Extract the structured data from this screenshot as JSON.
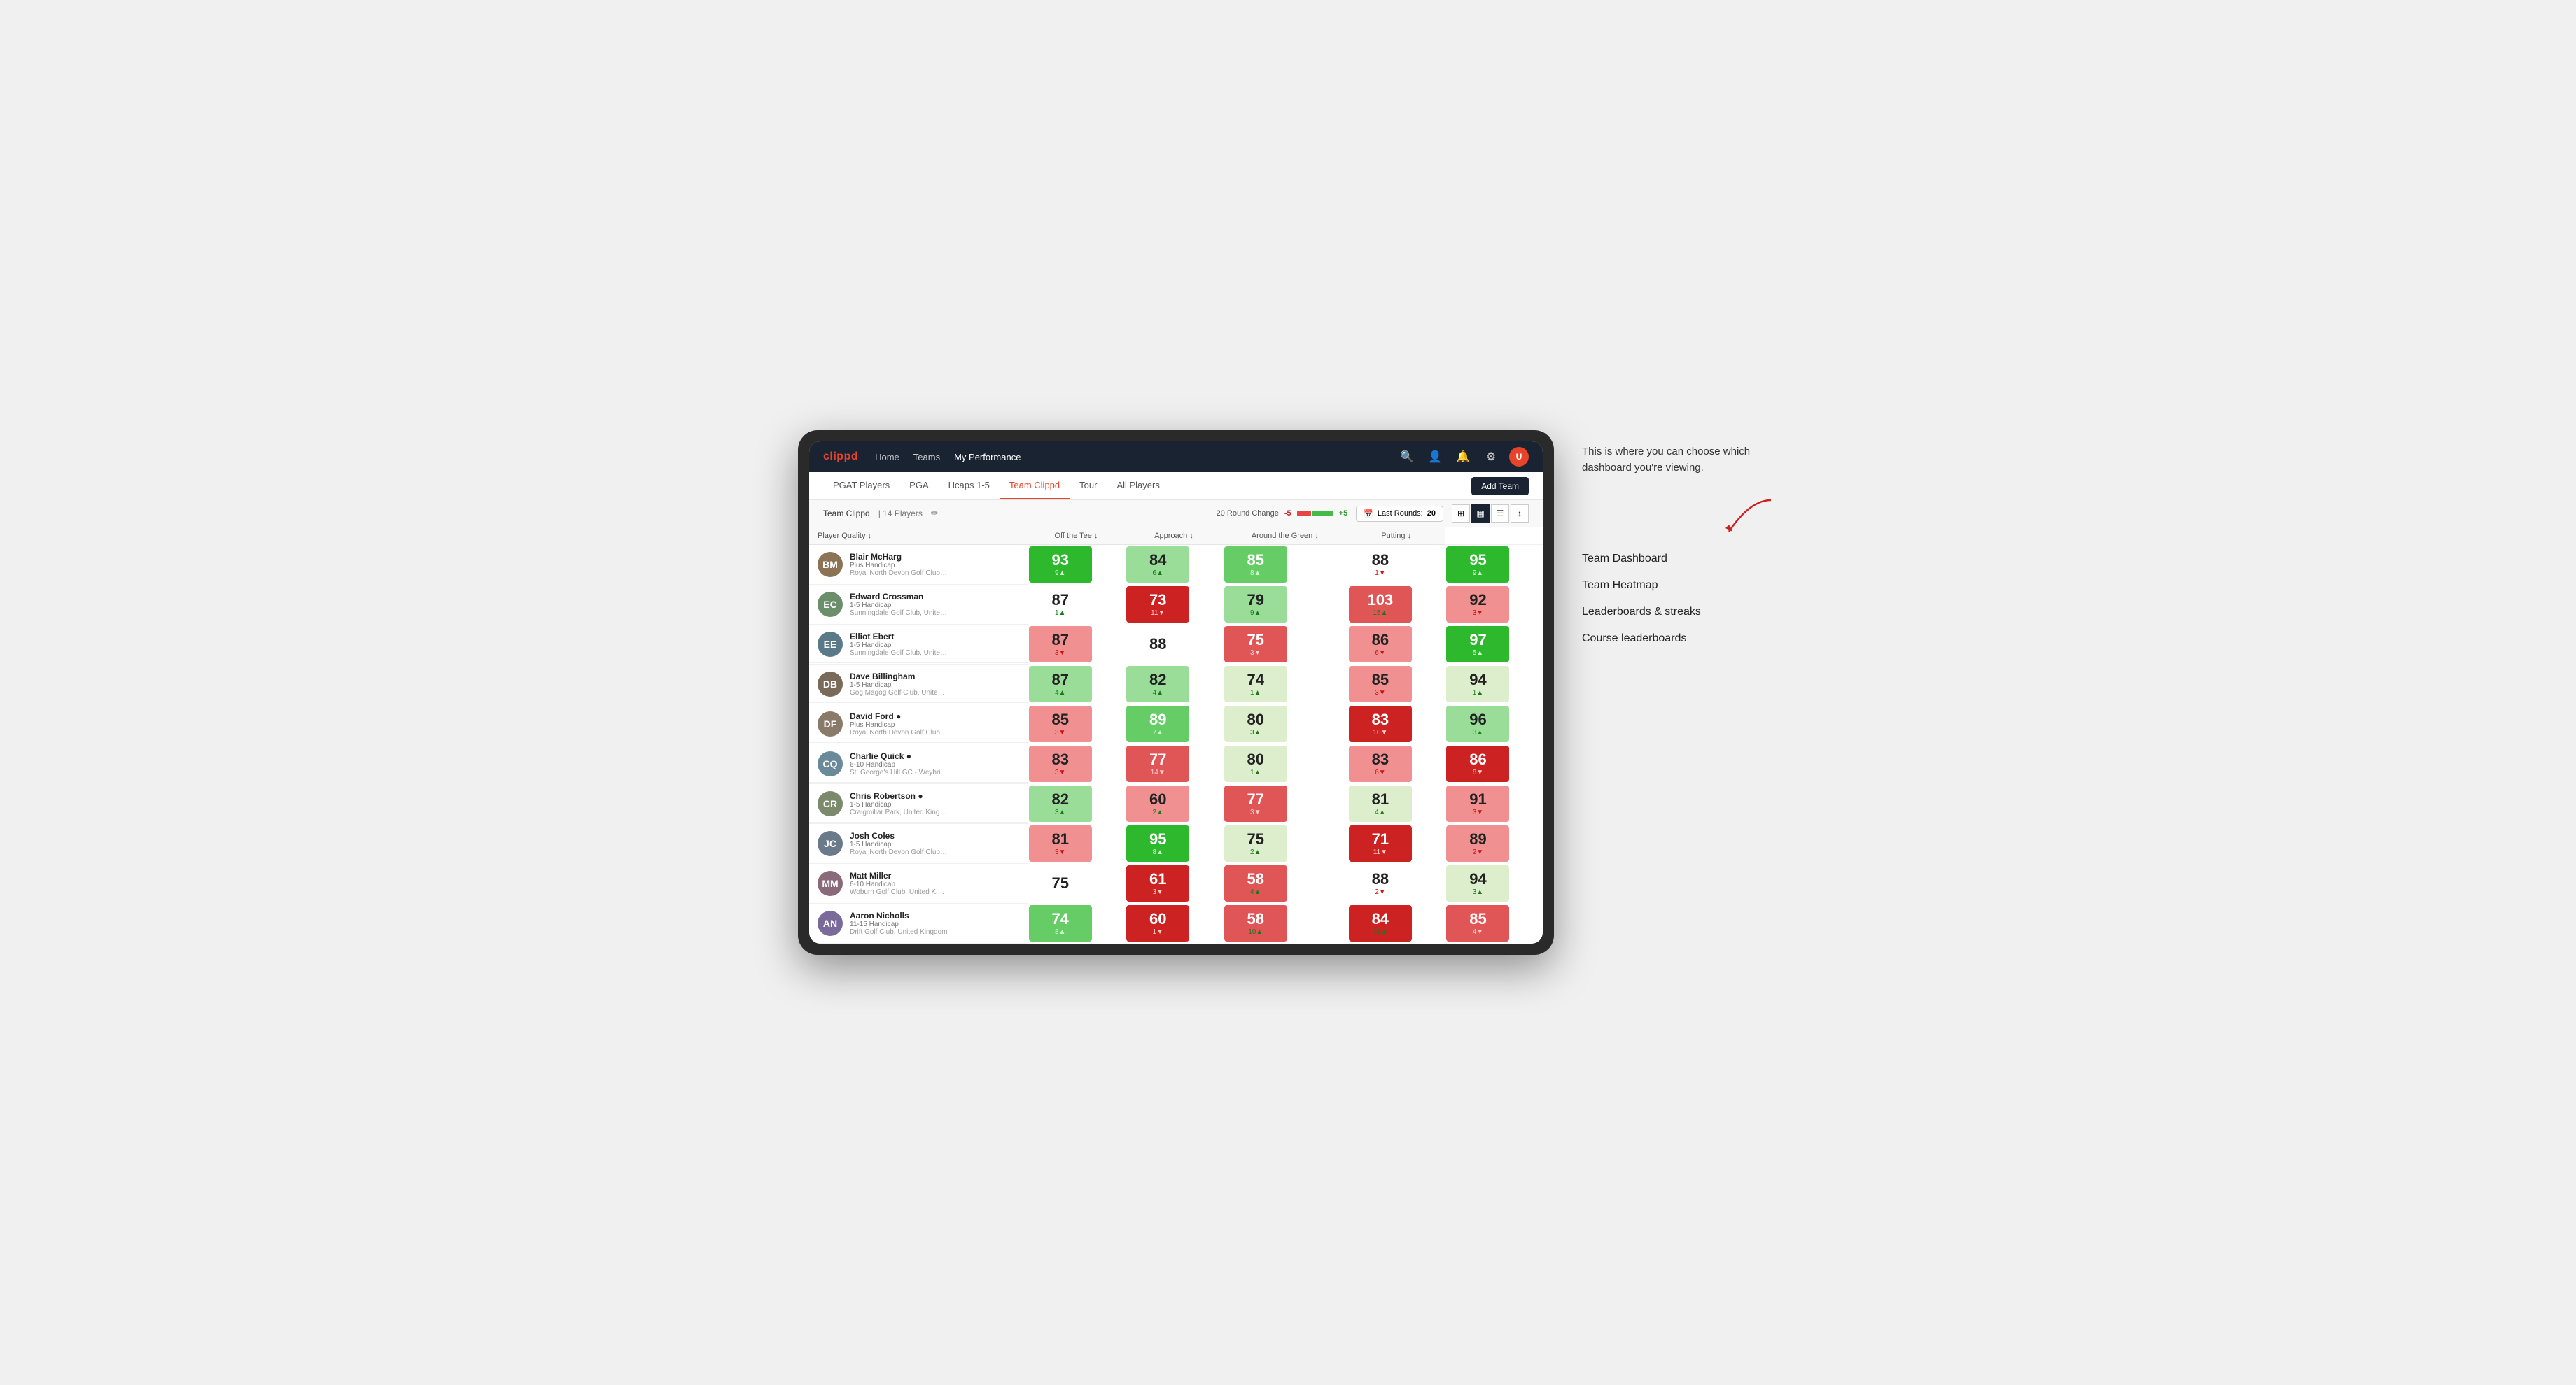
{
  "annotation": {
    "intro_text": "This is where you can choose which dashboard you're viewing.",
    "options": [
      "Team Dashboard",
      "Team Heatmap",
      "Leaderboards & streaks",
      "Course leaderboards"
    ]
  },
  "nav": {
    "logo": "clippd",
    "links": [
      "Home",
      "Teams",
      "My Performance"
    ],
    "active_link": "My Performance"
  },
  "sub_nav": {
    "links": [
      "PGAT Players",
      "PGA",
      "Hcaps 1-5",
      "Team Clippd",
      "Tour",
      "All Players"
    ],
    "active_link": "Team Clippd",
    "add_team_label": "Add Team"
  },
  "team_header": {
    "name": "Team Clippd",
    "separator": "|",
    "count": "14 Players",
    "round_change_label": "20 Round Change",
    "round_change_neg": "-5",
    "round_change_pos": "+5",
    "last_rounds_label": "Last Rounds:",
    "last_rounds_value": "20"
  },
  "table": {
    "columns": [
      "Player Quality ↓",
      "Off the Tee ↓",
      "Approach ↓",
      "Around the Green ↓",
      "Putting ↓"
    ],
    "players": [
      {
        "name": "Blair McHarg",
        "handicap": "Plus Handicap",
        "club": "Royal North Devon Golf Club, United Kingdom",
        "initials": "BM",
        "color": "#8B7355",
        "scores": [
          {
            "val": "93",
            "change": "9▲",
            "dir": "up",
            "bg": "bg-green-dark"
          },
          {
            "val": "84",
            "change": "6▲",
            "dir": "up",
            "bg": "bg-green-light"
          },
          {
            "val": "85",
            "change": "8▲",
            "dir": "up",
            "bg": "bg-green-mid"
          },
          {
            "val": "88",
            "change": "1▼",
            "dir": "down",
            "bg": "bg-white"
          },
          {
            "val": "95",
            "change": "9▲",
            "dir": "up",
            "bg": "bg-green-dark"
          }
        ]
      },
      {
        "name": "Edward Crossman",
        "handicap": "1-5 Handicap",
        "club": "Sunningdale Golf Club, United Kingdom",
        "initials": "EC",
        "color": "#6B8E6B",
        "scores": [
          {
            "val": "87",
            "change": "1▲",
            "dir": "up",
            "bg": "bg-white"
          },
          {
            "val": "73",
            "change": "11▼",
            "dir": "down",
            "bg": "bg-red-dark"
          },
          {
            "val": "79",
            "change": "9▲",
            "dir": "up",
            "bg": "bg-green-light"
          },
          {
            "val": "103",
            "change": "15▲",
            "dir": "up",
            "bg": "bg-red-mid"
          },
          {
            "val": "92",
            "change": "3▼",
            "dir": "down",
            "bg": "bg-red-light"
          }
        ]
      },
      {
        "name": "Elliot Ebert",
        "handicap": "1-5 Handicap",
        "club": "Sunningdale Golf Club, United Kingdom",
        "initials": "EE",
        "color": "#5a7a8a",
        "scores": [
          {
            "val": "87",
            "change": "3▼",
            "dir": "down",
            "bg": "bg-red-light"
          },
          {
            "val": "88",
            "change": "",
            "dir": "neutral",
            "bg": "bg-white"
          },
          {
            "val": "75",
            "change": "3▼",
            "dir": "down",
            "bg": "bg-red-mid"
          },
          {
            "val": "86",
            "change": "6▼",
            "dir": "down",
            "bg": "bg-red-light"
          },
          {
            "val": "97",
            "change": "5▲",
            "dir": "up",
            "bg": "bg-green-dark"
          }
        ]
      },
      {
        "name": "Dave Billingham",
        "handicap": "1-5 Handicap",
        "club": "Gog Magog Golf Club, United Kingdom",
        "initials": "DB",
        "color": "#7a6a5a",
        "scores": [
          {
            "val": "87",
            "change": "4▲",
            "dir": "up",
            "bg": "bg-green-light"
          },
          {
            "val": "82",
            "change": "4▲",
            "dir": "up",
            "bg": "bg-green-light"
          },
          {
            "val": "74",
            "change": "1▲",
            "dir": "up",
            "bg": "bg-green-pale"
          },
          {
            "val": "85",
            "change": "3▼",
            "dir": "down",
            "bg": "bg-red-light"
          },
          {
            "val": "94",
            "change": "1▲",
            "dir": "up",
            "bg": "bg-green-pale"
          }
        ]
      },
      {
        "name": "David Ford ●",
        "handicap": "Plus Handicap",
        "club": "Royal North Devon Golf Club, United Kingdom",
        "initials": "DF",
        "color": "#8a7a6a",
        "scores": [
          {
            "val": "85",
            "change": "3▼",
            "dir": "down",
            "bg": "bg-red-light"
          },
          {
            "val": "89",
            "change": "7▲",
            "dir": "up",
            "bg": "bg-green-mid"
          },
          {
            "val": "80",
            "change": "3▲",
            "dir": "up",
            "bg": "bg-green-pale"
          },
          {
            "val": "83",
            "change": "10▼",
            "dir": "down",
            "bg": "bg-red-dark"
          },
          {
            "val": "96",
            "change": "3▲",
            "dir": "up",
            "bg": "bg-green-light"
          }
        ]
      },
      {
        "name": "Charlie Quick ●",
        "handicap": "6-10 Handicap",
        "club": "St. George's Hill GC - Weybridge - Surrey, Uni...",
        "initials": "CQ",
        "color": "#6a8a9a",
        "scores": [
          {
            "val": "83",
            "change": "3▼",
            "dir": "down",
            "bg": "bg-red-light"
          },
          {
            "val": "77",
            "change": "14▼",
            "dir": "down",
            "bg": "bg-red-mid"
          },
          {
            "val": "80",
            "change": "1▲",
            "dir": "up",
            "bg": "bg-green-pale"
          },
          {
            "val": "83",
            "change": "6▼",
            "dir": "down",
            "bg": "bg-red-light"
          },
          {
            "val": "86",
            "change": "8▼",
            "dir": "down",
            "bg": "bg-red-dark"
          }
        ]
      },
      {
        "name": "Chris Robertson ●",
        "handicap": "1-5 Handicap",
        "club": "Craigmillar Park, United Kingdom",
        "initials": "CR",
        "color": "#7a8a6a",
        "scores": [
          {
            "val": "82",
            "change": "3▲",
            "dir": "up",
            "bg": "bg-green-light"
          },
          {
            "val": "60",
            "change": "2▲",
            "dir": "up",
            "bg": "bg-red-light"
          },
          {
            "val": "77",
            "change": "3▼",
            "dir": "down",
            "bg": "bg-red-mid"
          },
          {
            "val": "81",
            "change": "4▲",
            "dir": "up",
            "bg": "bg-green-pale"
          },
          {
            "val": "91",
            "change": "3▼",
            "dir": "down",
            "bg": "bg-red-light"
          }
        ]
      },
      {
        "name": "Josh Coles",
        "handicap": "1-5 Handicap",
        "club": "Royal North Devon Golf Club, United Kingdom",
        "initials": "JC",
        "color": "#6a7a8a",
        "scores": [
          {
            "val": "81",
            "change": "3▼",
            "dir": "down",
            "bg": "bg-red-light"
          },
          {
            "val": "95",
            "change": "8▲",
            "dir": "up",
            "bg": "bg-green-dark"
          },
          {
            "val": "75",
            "change": "2▲",
            "dir": "up",
            "bg": "bg-green-pale"
          },
          {
            "val": "71",
            "change": "11▼",
            "dir": "down",
            "bg": "bg-red-dark"
          },
          {
            "val": "89",
            "change": "2▼",
            "dir": "down",
            "bg": "bg-red-light"
          }
        ]
      },
      {
        "name": "Matt Miller",
        "handicap": "6-10 Handicap",
        "club": "Woburn Golf Club, United Kingdom",
        "initials": "MM",
        "color": "#8a6a7a",
        "scores": [
          {
            "val": "75",
            "change": "",
            "dir": "neutral",
            "bg": "bg-white"
          },
          {
            "val": "61",
            "change": "3▼",
            "dir": "down",
            "bg": "bg-red-dark"
          },
          {
            "val": "58",
            "change": "4▲",
            "dir": "up",
            "bg": "bg-red-mid"
          },
          {
            "val": "88",
            "change": "2▼",
            "dir": "down",
            "bg": "bg-white"
          },
          {
            "val": "94",
            "change": "3▲",
            "dir": "up",
            "bg": "bg-green-pale"
          }
        ]
      },
      {
        "name": "Aaron Nicholls",
        "handicap": "11-15 Handicap",
        "club": "Drift Golf Club, United Kingdom",
        "initials": "AN",
        "color": "#7a6a9a",
        "scores": [
          {
            "val": "74",
            "change": "8▲",
            "dir": "up",
            "bg": "bg-green-mid"
          },
          {
            "val": "60",
            "change": "1▼",
            "dir": "down",
            "bg": "bg-red-dark"
          },
          {
            "val": "58",
            "change": "10▲",
            "dir": "up",
            "bg": "bg-red-mid"
          },
          {
            "val": "84",
            "change": "21▲",
            "dir": "up",
            "bg": "bg-red-dark"
          },
          {
            "val": "85",
            "change": "4▼",
            "dir": "down",
            "bg": "bg-red-mid"
          }
        ]
      }
    ]
  }
}
